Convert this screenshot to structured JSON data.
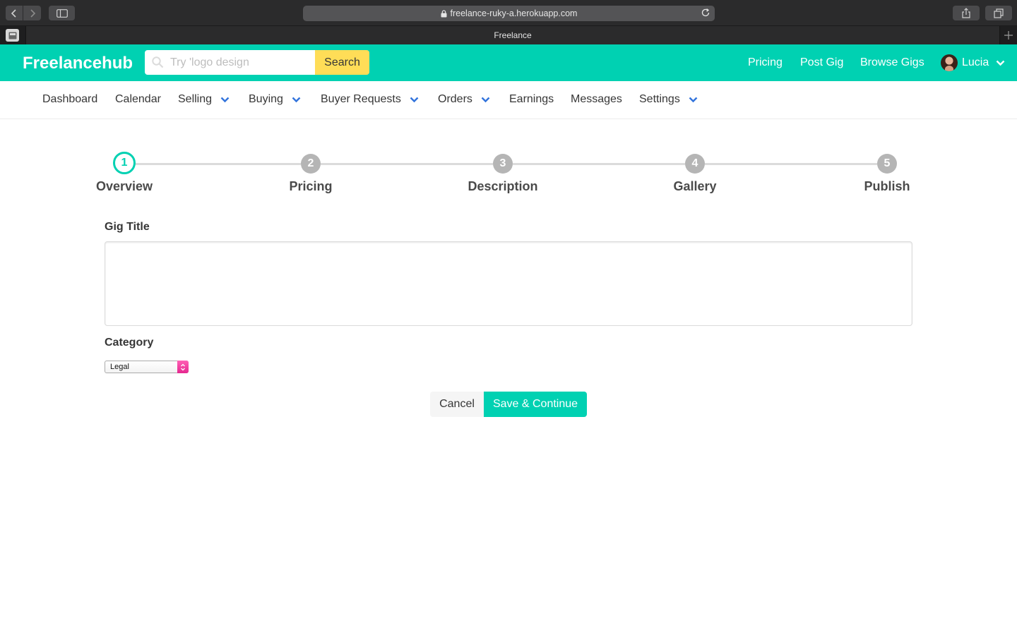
{
  "browser": {
    "url": "freelance-ruky-a.herokuapp.com",
    "tab_title": "Freelance"
  },
  "header": {
    "brand": "Freelancehub",
    "search_placeholder": "Try 'logo design",
    "search_button": "Search",
    "links": [
      "Pricing",
      "Post Gig",
      "Browse Gigs"
    ],
    "user_name": "Lucia"
  },
  "subnav": {
    "items": [
      "Dashboard",
      "Calendar",
      "Selling",
      "Buying",
      "Buyer Requests",
      "Orders",
      "Earnings",
      "Messages",
      "Settings"
    ]
  },
  "steps": {
    "items": [
      {
        "number": "1",
        "label": "Overview"
      },
      {
        "number": "2",
        "label": "Pricing"
      },
      {
        "number": "3",
        "label": "Description"
      },
      {
        "number": "4",
        "label": "Gallery"
      },
      {
        "number": "5",
        "label": "Publish"
      }
    ],
    "current": 1
  },
  "form": {
    "gig_title_label": "Gig Title",
    "gig_title_value": "",
    "category_label": "Category",
    "category_value": "Legal",
    "cancel_label": "Cancel",
    "save_label": "Save & Continue"
  },
  "colors": {
    "primary": "#00d1b2",
    "search_button": "#ffdd57",
    "nav_chevron": "#3273dc"
  }
}
